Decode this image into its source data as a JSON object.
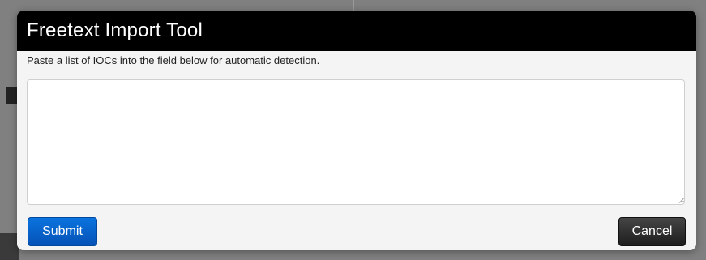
{
  "modal": {
    "title": "Freetext Import Tool",
    "instructions": "Paste a list of IOCs into the field below for automatic detection.",
    "textarea": {
      "value": "",
      "placeholder": ""
    },
    "submit_label": "Submit",
    "cancel_label": "Cancel"
  },
  "colors": {
    "header_bg": "#000000",
    "body_bg": "#f4f4f4",
    "submit_bg": "#0a6ad6",
    "cancel_bg": "#2b2b2b",
    "overlay": "#808080"
  },
  "icons": {
    "resize": "resize-grip-icon"
  }
}
